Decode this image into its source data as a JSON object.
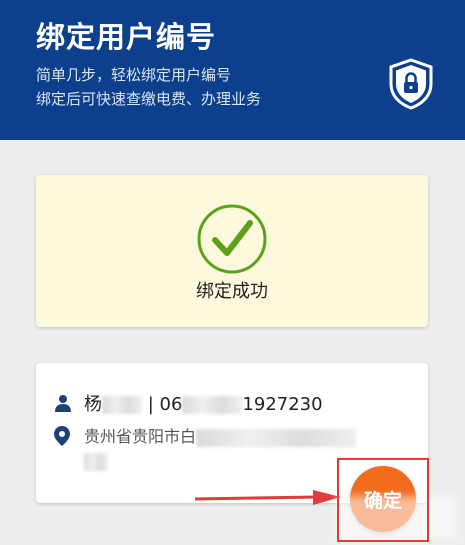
{
  "header": {
    "title": "绑定用户编号",
    "subtitle_line1": "简单几步，轻松绑定用户编号",
    "subtitle_line2": "绑定后可快速查缴电费、办理业务"
  },
  "success": {
    "message": "绑定成功"
  },
  "account": {
    "name_prefix": "杨",
    "separator": " | ",
    "number_prefix": "06",
    "number_suffix": "1927230",
    "address_prefix": "贵州省贵阳市白"
  },
  "actions": {
    "confirm_label": "确定"
  },
  "colors": {
    "header_bg": "#0c3f8c",
    "success_bg": "#fef8dc",
    "check_green": "#5aa21a",
    "confirm_orange": "#f26b1d",
    "annotation_red": "#e23b3b",
    "icon_navy": "#1e3f78"
  }
}
